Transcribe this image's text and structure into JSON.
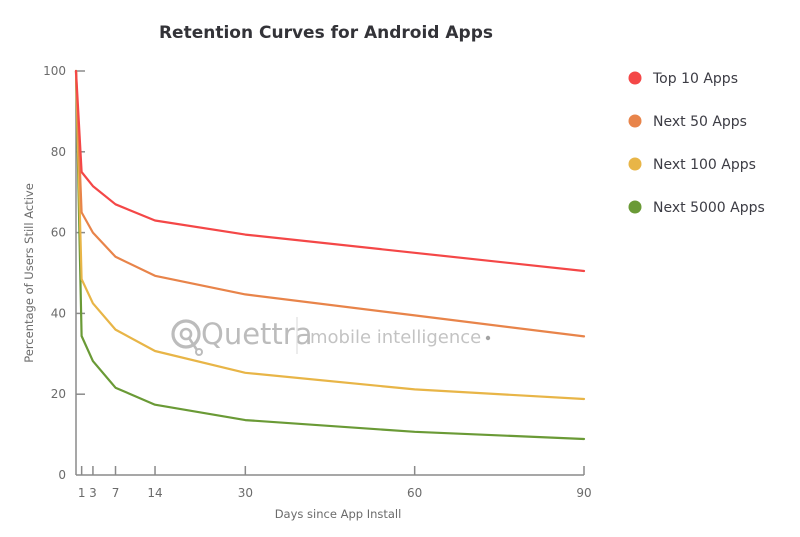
{
  "chart_data": {
    "type": "line",
    "title": "Retention Curves for Android Apps",
    "xlabel": "Days since App Install",
    "ylabel": "Percentage of Users Still Active",
    "x": [
      0,
      1,
      3,
      7,
      14,
      30,
      60,
      90
    ],
    "x_ticks": [
      1,
      3,
      7,
      14,
      30,
      60,
      90
    ],
    "x_tick_labels": [
      "1",
      "3",
      "7",
      "14",
      "30",
      "60",
      "90"
    ],
    "y_ticks": [
      0,
      20,
      40,
      60,
      80,
      100
    ],
    "y_tick_labels": [
      "0",
      "20",
      "40",
      "60",
      "80",
      "100"
    ],
    "xlim": [
      0,
      90
    ],
    "ylim": [
      0,
      100
    ],
    "grid": false,
    "legend_position": "right",
    "series": [
      {
        "name": "Top 10 Apps",
        "color": "#f44747",
        "values": [
          100,
          75,
          71.5,
          67,
          63,
          59.5,
          55,
          50.5
        ]
      },
      {
        "name": "Next 50 Apps",
        "color": "#e8844a",
        "values": [
          100,
          65,
          60,
          54,
          49.3,
          44.7,
          39.5,
          34.3
        ]
      },
      {
        "name": "Next 100 Apps",
        "color": "#e8b547",
        "values": [
          100,
          48.5,
          42.5,
          36,
          30.7,
          25.3,
          21.2,
          18.8
        ]
      },
      {
        "name": "Next 5000 Apps",
        "color": "#6a9a36",
        "values": [
          100,
          34.4,
          28.2,
          21.6,
          17.4,
          13.6,
          10.7,
          8.9
        ]
      }
    ]
  },
  "watermark": {
    "brand": "Quettra",
    "tagline": "mobile intelligence"
  }
}
